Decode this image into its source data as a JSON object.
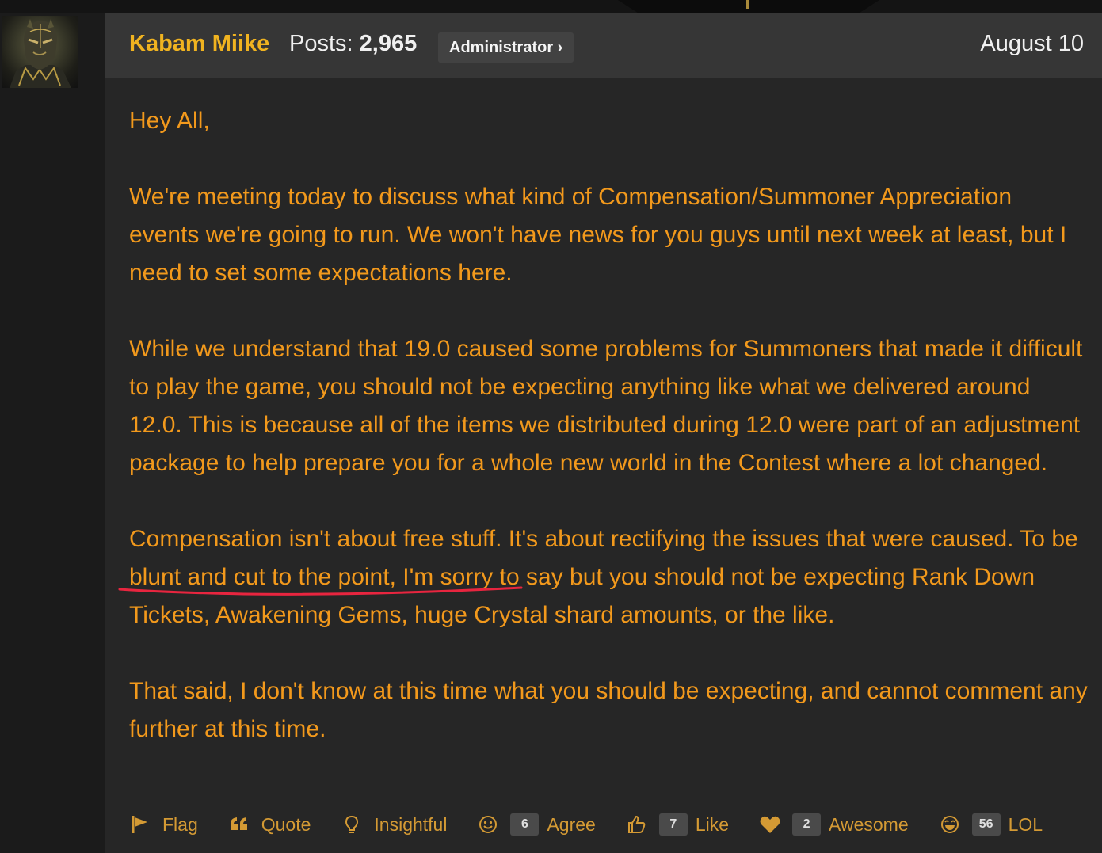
{
  "post": {
    "author": "Kabam Miike",
    "posts_label": "Posts:",
    "posts_count": "2,965",
    "role": "Administrator ›",
    "date": "August 10",
    "paragraphs": [
      "Hey All,",
      "We're meeting today to discuss what kind of Compensation/Summoner Appreciation events we're going to run. We won't have news for you guys until next week at least, but I need to set some expectations here.",
      "While we understand that 19.0 caused some problems for Summoners that made it difficult to play the game, you should not be expecting anything like what we delivered around 12.0. This is because all of the items we distributed during 12.0 were part of an adjustment package to help prepare you for a whole new world in the Contest where a lot changed.",
      "Compensation isn't about free stuff. It's about rectifying the issues that were caused. To be blunt and cut to the point, I'm sorry to say but you should not be expecting Rank Down Tickets, Awakening Gems, huge Crystal shard amounts, or the like.",
      "That said, I don't know at this time what you should be expecting, and cannot comment any further at this time."
    ]
  },
  "reactions": [
    {
      "name": "flag",
      "icon": "flag-icon",
      "label": "Flag",
      "count": null
    },
    {
      "name": "quote",
      "icon": "quote-icon",
      "label": "Quote",
      "count": null
    },
    {
      "name": "insightful",
      "icon": "lightbulb-icon",
      "label": "Insightful",
      "count": null
    },
    {
      "name": "agree",
      "icon": "smiley-icon",
      "label": "Agree",
      "count": "6"
    },
    {
      "name": "like",
      "icon": "thumbs-up-icon",
      "label": "Like",
      "count": "7"
    },
    {
      "name": "awesome",
      "icon": "heart-icon",
      "label": "Awesome",
      "count": "2"
    },
    {
      "name": "lol",
      "icon": "laughing-icon",
      "label": "LOL",
      "count": "56"
    }
  ],
  "colors": {
    "author": "#f0b320",
    "body_text": "#f2991c",
    "annotation_underline": "#e8253f",
    "reaction_text": "#d49a34",
    "header_bg": "#363636",
    "post_bg": "#262626"
  }
}
